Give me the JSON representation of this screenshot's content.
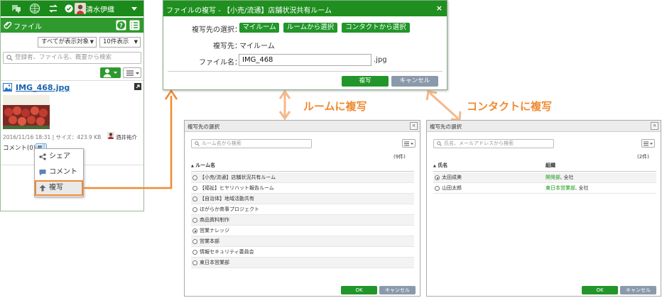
{
  "colors": {
    "brand_green": "#1f8f1f",
    "accent_orange": "#f08a30",
    "link_blue": "#1a63b0",
    "cancel_gray": "#8a9aab"
  },
  "left_panel": {
    "user_name": "清水伊織",
    "section_title": "ファイル",
    "filter_select": "すべてが表示対象",
    "per_page_select": "10件表示",
    "search_placeholder": "登録者、ファイル名、概要から検索",
    "file": {
      "name": "IMG_468.jpg",
      "meta": "2016/11/16 18:31 | サイズ：423.9 KB",
      "uploader": "酒井祐介",
      "comment_label": "コメント(0)",
      "comment_badge": "0"
    },
    "context_menu": {
      "share": "シェア",
      "comment": "コメント",
      "copy": "複写"
    }
  },
  "copy_dialog": {
    "title": "ファイルの複写 - 【小売/流通】店舗状況共有ルーム",
    "close_glyph": "×",
    "dest_select_label": "複写先の選択：",
    "btn_my_room": "マイルーム",
    "btn_from_room": "ルームから選択",
    "btn_from_contact": "コンタクトから選択",
    "dest_label": "複写先：",
    "dest_value": "マイルーム",
    "filename_label": "ファイル名：",
    "filename_value": "IMG_468",
    "extension": ".jpg",
    "ok_label": "複写",
    "cancel_label": "キャンセル"
  },
  "annotations": {
    "room_copy": "ルームに複写",
    "contact_copy": "コンタクトに複写"
  },
  "room_dialog": {
    "title": "複写先の選択",
    "close_glyph": "×",
    "search_placeholder": "ルーム名から検索",
    "count": "(9件)",
    "column_header": "ルーム名",
    "selected_index": 6,
    "rooms": [
      "【小売/流通】店舗状況共有ルーム",
      "【福祉】ヒヤリハット報告ルーム",
      "【自治体】地域活動共有",
      "ほがらか商事プロジェクト",
      "商品資料制作",
      "営業ナレッジ",
      "営業本部",
      "情報セキュリティ委員会",
      "東日本営業部"
    ],
    "ok_label": "OK",
    "cancel_label": "キャンセル"
  },
  "contact_dialog": {
    "title": "複写先の選択",
    "close_glyph": "×",
    "search_placeholder": "氏名、メールアドレスから検索",
    "count": "(2件)",
    "column_name": "氏名",
    "column_org": "組織",
    "contacts": [
      {
        "name": "太田成美",
        "org_link": "開発部",
        "org_rest": ", 全社",
        "selected": true
      },
      {
        "name": "山田太郎",
        "org_link": "東日本営業部",
        "org_rest": ", 全社",
        "selected": false
      }
    ],
    "ok_label": "OK",
    "cancel_label": "キャンセル"
  }
}
